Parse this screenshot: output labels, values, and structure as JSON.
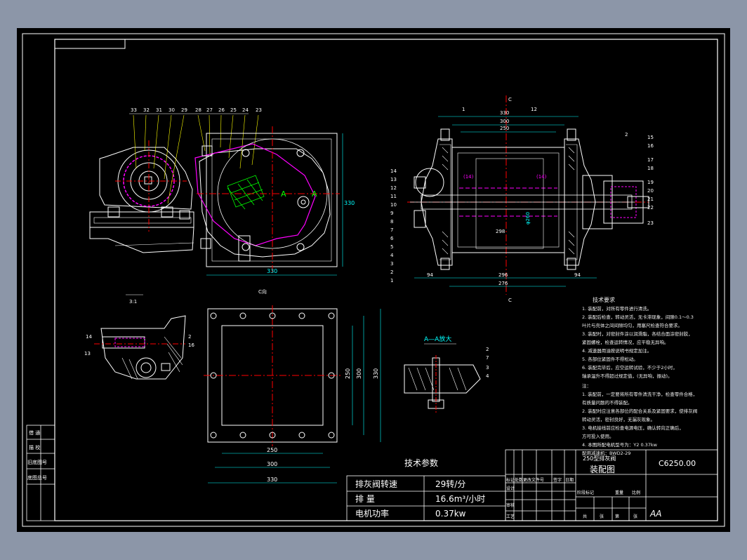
{
  "drawing": {
    "title_block": {
      "model": "250型排灰阀",
      "name": "装配图",
      "drawing_no": "C6250.00",
      "headers_row": [
        "标记",
        "处数",
        "更改文件号",
        "签字",
        "日期"
      ],
      "left_labels": [
        "设计",
        "审核",
        "工艺"
      ],
      "stage_labels": [
        "阶段标记",
        "重量",
        "比例"
      ],
      "sheet_labels": [
        "共",
        "张",
        "第",
        "张"
      ],
      "logo_text": "AA"
    },
    "side_stamps": [
      "借 通",
      "描 校",
      "旧底图号",
      "底图总号"
    ],
    "tech_params": {
      "heading": "技术参数",
      "rows": [
        {
          "label": "排灰阀转速",
          "value": "29转/分"
        },
        {
          "label": "排 量",
          "value": "16.6m³/小时"
        },
        {
          "label": "电机功率",
          "value": "0.37kw"
        }
      ]
    },
    "view_labels": {
      "section_mark": "A―A放大",
      "scale": "3:1",
      "dir_view": "C向",
      "cut_a": "A",
      "cut_c": "C"
    },
    "dimensions": {
      "top_330": "330",
      "top_300": "300",
      "top_250": "250",
      "front_330": "330",
      "side_330": "330",
      "bottom_296": "296",
      "bottom_276": "276",
      "bottom_94a": "94",
      "bottom_94b": "94",
      "diam": "φ260",
      "inner_298": "298",
      "bore_14a": "(14)",
      "bore_14b": "(14)",
      "plan_250": "250",
      "plan_300": "300",
      "plan_330": "330",
      "plan_v250": "250",
      "plan_v300": "300",
      "plan_v330": "330"
    },
    "balloons_top": [
      "33",
      "32",
      "31",
      "30",
      "29",
      "28",
      "27",
      "26",
      "25",
      "24",
      "23"
    ],
    "balloons_left": [
      "14",
      "13",
      "12",
      "11",
      "10",
      "9",
      "8",
      "7",
      "6",
      "5",
      "4",
      "3",
      "2",
      "1"
    ],
    "balloons_right": [
      "15",
      "16",
      "17",
      "18",
      "19",
      "20",
      "21",
      "22",
      "23"
    ],
    "balloons_misc": [
      "1",
      "12",
      "2",
      "14",
      "13",
      "2",
      "16",
      "2",
      "7",
      "3",
      "4"
    ],
    "notes": {
      "heading": "技术要求",
      "lines": [
        "1. 装配前，对所有零件进行清洗。",
        "2. 装配后检查，转动灵活，无卡滞现象，间隙0.1～0.3",
        "   叶片与壳体之间间隙均匀，用塞尺检查符合要求。",
        "3. 装配时，对密封件涂以润滑脂，各结合面涂密封胶，",
        "   紧固螺栓，检查运转情况，应平稳无异响。",
        "4. 减速器用油按说明书规定加注。",
        "5. 各部位紧固件不得松动。",
        "6. 装配完毕后，应空运转试验，不少于2小时，",
        "   轴承温升不得超过规定值，(无异响，振动)。",
        "注：",
        "1. 装配前，一定要将所有零件清洗干净，检查零件合格，",
        "   有质量问题的不得装配。",
        "2. 装配时应注意各部位的配合关系及紧固要求，使排灰阀",
        "   转动灵活，密封良好，无漏灰现象。",
        "3. 电机接线前应检查电源电压，确认转向正确后，",
        "   方可投入使用。",
        "4. 本图所配电机型号为：Y2  0.37kw",
        "   配用减速机：BWD2-29"
      ]
    }
  }
}
